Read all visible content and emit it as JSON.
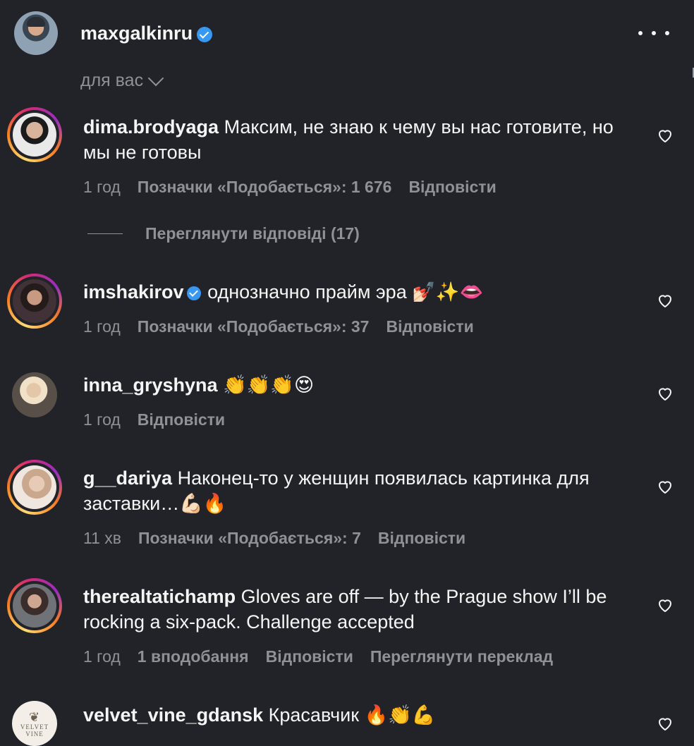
{
  "header": {
    "username": "maxgalkinru",
    "verified": true
  },
  "sort": {
    "label": "для вас"
  },
  "comments": [
    {
      "username": "dima.brodyaga",
      "verified": false,
      "text": "Максим, не знаю к чему вы нас готовите, но мы не готовы",
      "time": "1 год",
      "likes": "Позначки «Подобається»: 1 676",
      "reply": "Відповісти",
      "view_replies": "Переглянути відповіді (17)"
    },
    {
      "username": "imshakirov",
      "verified": true,
      "text": "однозначно прайм эра 💅🏻✨👄",
      "time": "1 год",
      "likes": "Позначки «Подобається»: 37",
      "reply": "Відповісти"
    },
    {
      "username": "inna_gryshyna",
      "verified": false,
      "text": "👏👏👏😍",
      "time": "1 год",
      "reply": "Відповісти"
    },
    {
      "username": "g__dariya",
      "verified": false,
      "text": "Наконец-то у женщин появилась картинка для заставки…💪🏻🔥",
      "time": "11 хв",
      "likes": "Позначки «Подобається»: 7",
      "reply": "Відповісти"
    },
    {
      "username": "therealtatichamp",
      "verified": false,
      "text": "Gloves are off — by the Prague show I’ll be rocking a six-pack. Challenge accepted",
      "time": "1 год",
      "likes": "1 вподобання",
      "reply": "Відповісти",
      "translate": "Переглянути переклад"
    },
    {
      "username": "velvet_vine_gdansk",
      "verified": false,
      "text": "Красавчик 🔥👏💪",
      "avatar_text": "VELVET VINE"
    }
  ],
  "icons": {
    "more": "more-icon",
    "heart": "heart-outline-icon",
    "verified": "verified-badge-icon",
    "chevron": "chevron-down-icon"
  },
  "colors": {
    "background": "#212328",
    "text": "#f5f5f5",
    "muted": "#8e9196",
    "verified": "#3897f0"
  }
}
